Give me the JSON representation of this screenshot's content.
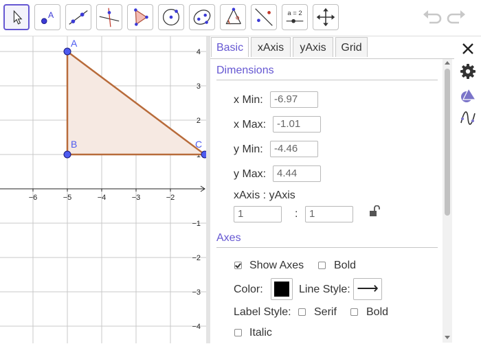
{
  "toolbar": {
    "tools": [
      "move-tool",
      "point-tool",
      "line-tool",
      "perpendicular-line-tool",
      "polygon-tool",
      "circle-with-center-tool",
      "ellipse-tool",
      "angle-tool",
      "reflect-about-line-tool",
      "slider-tool",
      "move-graphics-view-tool"
    ],
    "slider_label": "a = 2",
    "undo": "undo-icon",
    "redo": "redo-icon"
  },
  "graphics": {
    "x_ticks": [
      "−6",
      "−5",
      "−4",
      "−3",
      "−2"
    ],
    "y_ticks_pos": [
      "4",
      "3",
      "2",
      "1"
    ],
    "y_ticks_neg": [
      "−1",
      "−2",
      "−3",
      "−4"
    ],
    "points": {
      "A": "A",
      "B": "B",
      "C": "C"
    },
    "polygon_color": "#b86b3a",
    "polygon_fill": "#f6e9e2",
    "point_color": "#4040ff"
  },
  "tabs": {
    "basic": "Basic",
    "xaxis": "xAxis",
    "yaxis": "yAxis",
    "grid": "Grid"
  },
  "dimensions": {
    "heading": "Dimensions",
    "xmin_label": "x Min:",
    "xmin_value": "-6.97",
    "xmax_label": "x Max:",
    "xmax_value": "-1.01",
    "ymin_label": "y Min:",
    "ymin_value": "-4.46",
    "ymax_label": "y Max:",
    "ymax_value": "4.44",
    "ratio_label": "xAxis : yAxis",
    "ratio_x": "1",
    "ratio_sep": ":",
    "ratio_y": "1"
  },
  "axes": {
    "heading": "Axes",
    "show_axes": "Show Axes",
    "show_axes_checked": true,
    "bold": "Bold",
    "bold_checked": false,
    "color_label": "Color:",
    "color_value": "#000000",
    "line_style_label": "Line Style:",
    "line_style_glyph": "⟶",
    "label_style_label": "Label Style:",
    "serif": "Serif",
    "label_bold": "Bold",
    "italic": "Italic"
  },
  "sidebar": [
    "close-icon",
    "settings-gear-icon",
    "graphics-shapes-icon",
    "function-graph-icon"
  ],
  "accent": "#6557d2"
}
